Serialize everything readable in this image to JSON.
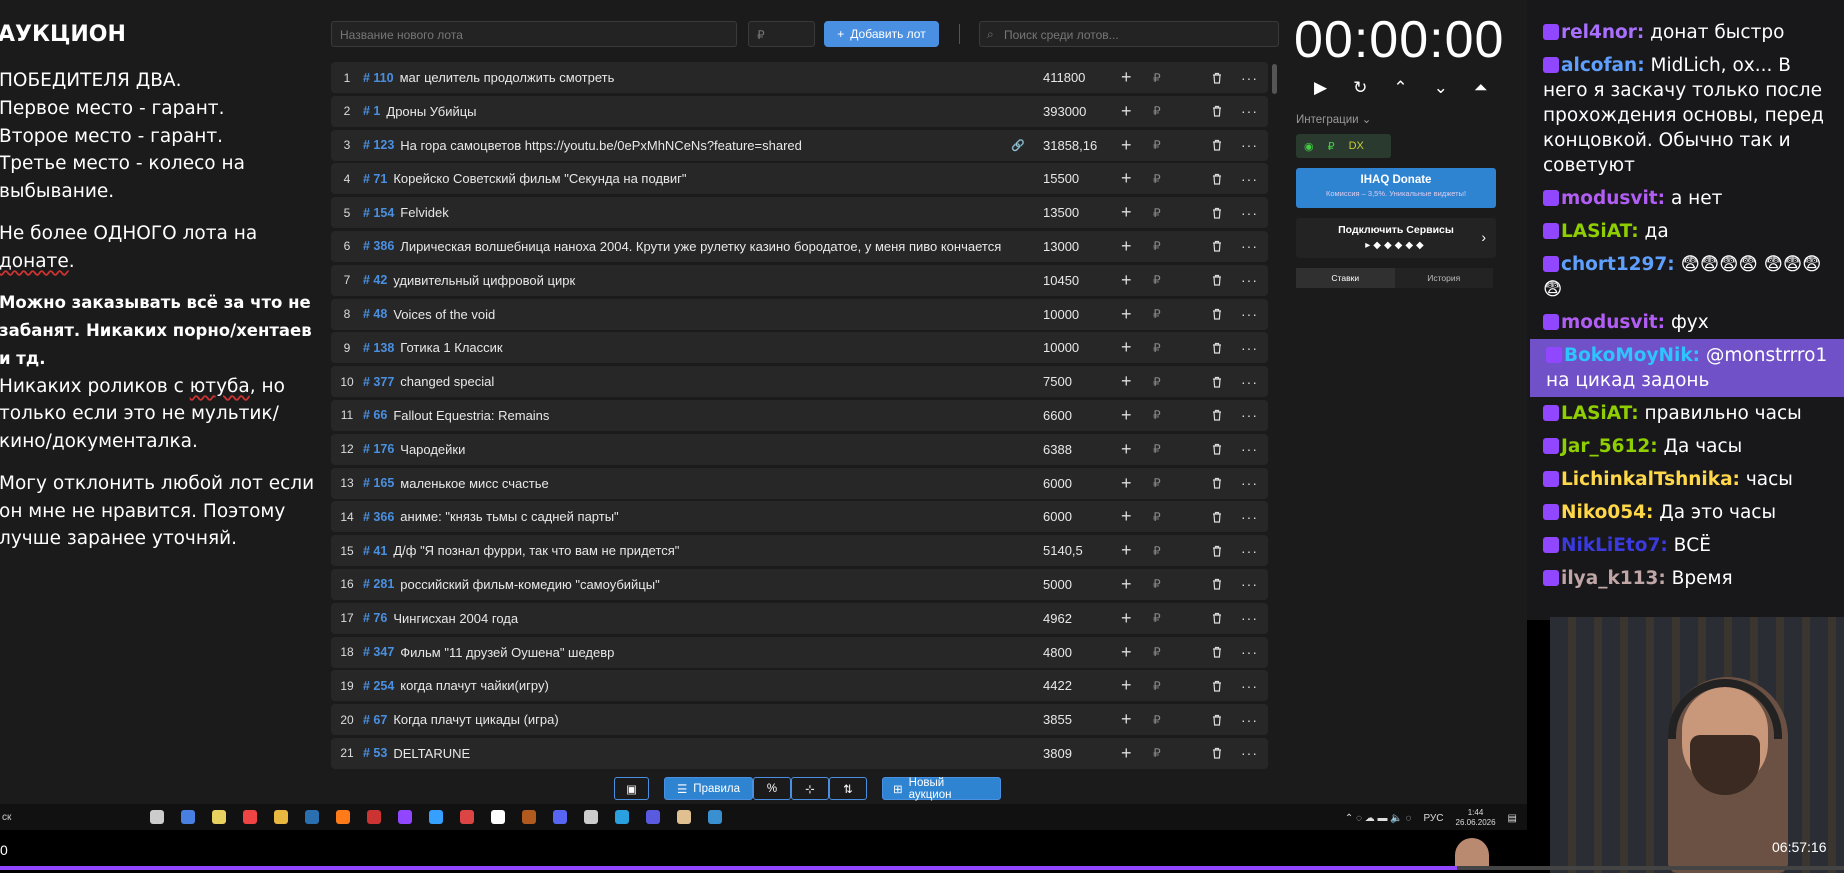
{
  "rules": {
    "title": "АУКЦИОН",
    "l1": "ПОБЕДИТЕЛЯ ДВА.",
    "l2": "Первое место - гарант.",
    "l3": "Второе место - гарант.",
    "l4": "Третье место - колесо на выбывание.",
    "l5a": "Не более ОДНОГО лота на ",
    "l5b": "донате",
    "l5c": ".",
    "l6": "Можно заказывать всё за что не забанят. Никаких порно/хентаев и тд.",
    "l7a": "Никаких роликов с ",
    "l7b": "ютуба",
    "l7c": ", но только если это не мультик/кино/документалка.",
    "l8": "Могу отклонить любой лот если он мне не нравится. Поэтому лучше заранее уточняй."
  },
  "topbar": {
    "name_placeholder": "Название нового лота",
    "amount_placeholder": "₽",
    "add_label": "Добавить лот",
    "search_placeholder": "Поиск среди лотов..."
  },
  "lots": [
    {
      "n": "1",
      "id": "# 110",
      "name": "маг целитель продолжить смотреть",
      "amount": "411800"
    },
    {
      "n": "2",
      "id": "# 1",
      "name": "Дроны Убийцы",
      "amount": "393000"
    },
    {
      "n": "3",
      "id": "# 123",
      "name": "На гора самоцветов https://youtu.be/0ePxMhNCeNs?feature=shared",
      "amount": "31858,16"
    },
    {
      "n": "4",
      "id": "# 71",
      "name": "Корейско Советский фильм \"Секунда на подвиг\"",
      "amount": "15500"
    },
    {
      "n": "5",
      "id": "# 154",
      "name": "Felvidek",
      "amount": "13500"
    },
    {
      "n": "6",
      "id": "# 386",
      "name": "Лирическая волшебница наноха 2004. Крути уже рулетку казино бородатое, у меня пиво кончается",
      "amount": "13000"
    },
    {
      "n": "7",
      "id": "# 42",
      "name": "удивительный цифровой цирк",
      "amount": "10450"
    },
    {
      "n": "8",
      "id": "# 48",
      "name": "Voices of the void",
      "amount": "10000"
    },
    {
      "n": "9",
      "id": "# 138",
      "name": "Готика 1 Классик",
      "amount": "10000"
    },
    {
      "n": "10",
      "id": "# 377",
      "name": "changed special",
      "amount": "7500"
    },
    {
      "n": "11",
      "id": "# 66",
      "name": "Fallout Equestria: Remains",
      "amount": "6600"
    },
    {
      "n": "12",
      "id": "# 176",
      "name": "Чародейки",
      "amount": "6388"
    },
    {
      "n": "13",
      "id": "# 165",
      "name": "маленькое мисс счастье",
      "amount": "6000"
    },
    {
      "n": "14",
      "id": "# 366",
      "name": "аниме: \"князь тьмы с садней парты\"",
      "amount": "6000"
    },
    {
      "n": "15",
      "id": "# 41",
      "name": "Д/ф \"Я познал фурри, так что вам не придется\"",
      "amount": "5140,5"
    },
    {
      "n": "16",
      "id": "# 281",
      "name": "российский фильм-комедию \"самоубийцы\"",
      "amount": "5000"
    },
    {
      "n": "17",
      "id": "# 76",
      "name": "Чингисхан 2004 года",
      "amount": "4962"
    },
    {
      "n": "18",
      "id": "# 347",
      "name": "Фильм \"11 друзей Оушена\" шедевр",
      "amount": "4800"
    },
    {
      "n": "19",
      "id": "# 254",
      "name": "когда плачут чайки(игру)",
      "amount": "4422"
    },
    {
      "n": "20",
      "id": "# 67",
      "name": "Когда плачут цикады (игра)",
      "amount": "3855"
    },
    {
      "n": "21",
      "id": "# 53",
      "name": "DELTARUNE",
      "amount": "3809"
    }
  ],
  "bottombar": {
    "rules": "Правила",
    "percent": "%",
    "new_auction": "Новый аукцион"
  },
  "panel": {
    "timer": "00:00:00",
    "integrations": "Интеграции",
    "donate_title": "IHAQ Donate",
    "donate_sub": "Комиссия – 3,5%. Уникальные виджеты!",
    "services": "Подключить Сервисы",
    "tab_bets": "Ставки",
    "tab_history": "История"
  },
  "taskbar": {
    "search": "ск",
    "lang": "РУС",
    "clock": "1:44",
    "date": "26.06.2026"
  },
  "chat": [
    {
      "nick": "rel4nor:",
      "text": " донат быстро",
      "color": "#a970ff"
    },
    {
      "nick": "alcofan:",
      "text": " MidLich, ох... В него я заскачу только после прохождения основы, перед концовкой. Обычно так и советуют",
      "color": "#5fa0ff"
    },
    {
      "nick": "modusvit:",
      "text": " а нет",
      "color": "#b25ef5"
    },
    {
      "nick": "LASiAT:",
      "text": " да",
      "color": "#8fce00"
    },
    {
      "nick": "chort1297:",
      "text": " 😨😨😨😨 😨😨😨😨",
      "color": "#5fa0ff"
    },
    {
      "nick": "modusvit:",
      "text": " фух",
      "color": "#b25ef5"
    },
    {
      "nick": "BokoMoyNik:",
      "text": " @monstrrro1 на цикад задонь",
      "color": "#2ec4ff",
      "hl": true
    },
    {
      "nick": "LASiAT:",
      "text": " правильно часы",
      "color": "#8fce00"
    },
    {
      "nick": "Jar_5612:",
      "text": " Да часы",
      "color": "#8fce00"
    },
    {
      "nick": "LichinkalTshnika:",
      "text": " часы",
      "color": "#ffd84a"
    },
    {
      "nick": "Niko054:",
      "text": " Да это часы",
      "color": "#ffd84a"
    },
    {
      "nick": "NikLiEto7:",
      "text": " ВСЁ",
      "color": "#3a3adf"
    },
    {
      "nick": "ilya_k113:",
      "text": " Время",
      "color": "#c0a6a6"
    }
  ],
  "video": {
    "timestamp": "06:57:16",
    "progress": 0.79
  }
}
